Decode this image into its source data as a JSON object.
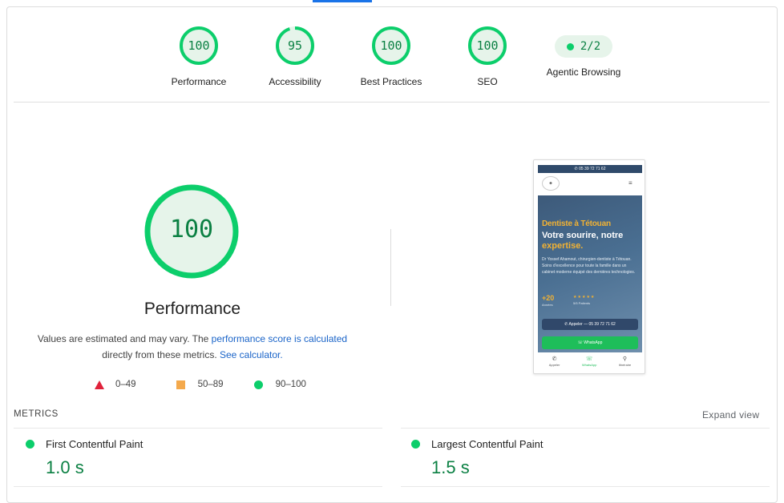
{
  "categories": [
    {
      "score": "100",
      "label": "Performance"
    },
    {
      "score": "95",
      "label": "Accessibility"
    },
    {
      "score": "100",
      "label": "Best Practices"
    },
    {
      "score": "100",
      "label": "SEO"
    }
  ],
  "agentic": {
    "value": "2/2",
    "label": "Agentic Browsing"
  },
  "performance": {
    "score": "100",
    "title": "Performance",
    "desc_pre": "Values are estimated and may vary. The ",
    "desc_link1": "performance score is calculated",
    "desc_mid": "directly from these metrics. ",
    "desc_link2": "See calculator.",
    "legend": {
      "fail": "0–49",
      "average": "50–89",
      "pass": "90–100"
    }
  },
  "screenshot": {
    "phone_number": "05 39 72 71 62",
    "kicker": "Dentiste à Tétouan",
    "headline": "Votre sourire, notre",
    "headline_accent": "expertise.",
    "paragraph": "Dr Yossef Ahamout, chirurgien-dentiste à Tétouan. Soins d'excellence pour toute la famille dans un cabinet moderne équipé des dernières technologies.",
    "stat_value": "+20",
    "stat_label": "Années",
    "stars": "★★★★★",
    "stars_label": "5/5 Patients",
    "call_button": "Appeler — 05 39 72 71 62",
    "whatsapp_button": "WhatsApp",
    "nav": [
      "Appeler",
      "WhatsApp",
      "Itinéraire"
    ]
  },
  "metrics": {
    "heading": "METRICS",
    "expand": "Expand view",
    "items": [
      {
        "name": "First Contentful Paint",
        "value": "1.0 s"
      },
      {
        "name": "Largest Contentful Paint",
        "value": "1.5 s"
      }
    ]
  },
  "colors": {
    "pass": "#0cce6b",
    "pass_text": "#0b8043",
    "average": "#f4a94c",
    "fail": "#e0223b",
    "link": "#1a64c8"
  }
}
